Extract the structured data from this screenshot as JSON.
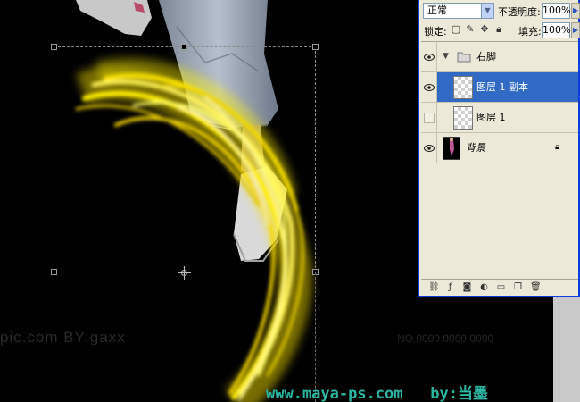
{
  "layers_panel": {
    "blend_mode": "正常",
    "opacity_label": "不透明度:",
    "opacity_value": "100%",
    "lock_label": "锁定:",
    "fill_label": "填充:",
    "fill_value": "100%",
    "layers": [
      {
        "name": "右脚",
        "type": "group",
        "visible": true,
        "icon": "folder-icon"
      },
      {
        "name": "图层 1 副本",
        "type": "layer",
        "visible": true,
        "selected": true
      },
      {
        "name": "图层 1",
        "type": "layer",
        "visible": false
      },
      {
        "name": "背景",
        "type": "background",
        "visible": true,
        "locked": true
      }
    ],
    "bottom_icons": [
      "link-icon",
      "fx-icon",
      "mask-icon",
      "adjustment-icon",
      "new-group-icon",
      "new-layer-icon",
      "trash-icon"
    ]
  },
  "canvas": {
    "watermark_left": "pic.com   BY:gaxx",
    "watermark_right": "NO.0000.0000.0000",
    "site_credit": "www.maya-ps.com   by:当墨"
  },
  "colors": {
    "selection": "#316ac5",
    "panel_bg": "#ece9d8",
    "credit": "#2bb5a3",
    "streak": "#ffee00"
  }
}
